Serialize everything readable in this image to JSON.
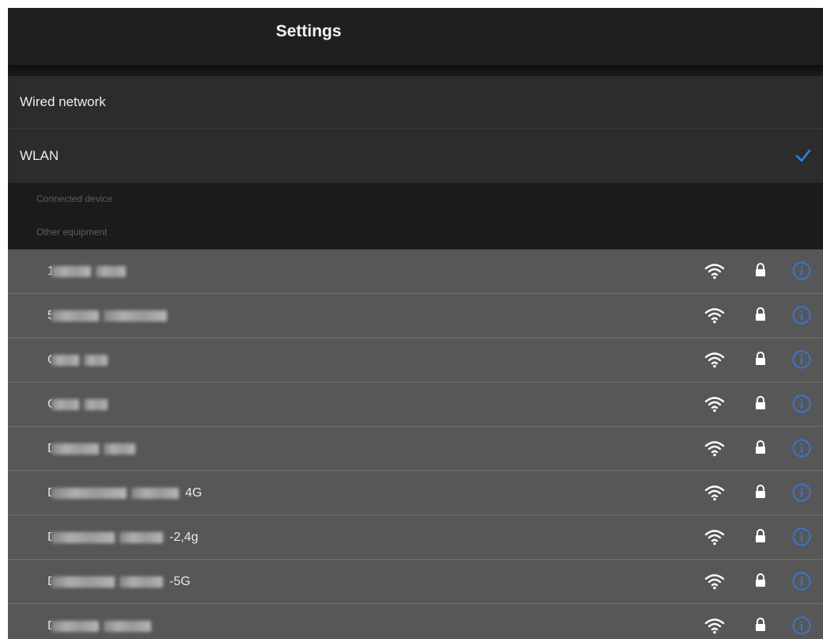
{
  "header": {
    "title": "Settings"
  },
  "menu": {
    "wired_label": "Wired network",
    "wlan_label": "WLAN",
    "wlan_checked": true,
    "accent_color": "#2f7df2"
  },
  "sections": {
    "connected_label": "Connected device",
    "other_label": "Other equipment"
  },
  "networks": [
    {
      "first": "1",
      "suffix": "",
      "secured": true
    },
    {
      "first": "5",
      "suffix": "",
      "secured": true
    },
    {
      "first": "C",
      "suffix": "",
      "secured": true
    },
    {
      "first": "C",
      "suffix": "",
      "secured": true
    },
    {
      "first": "D",
      "suffix": "",
      "secured": true
    },
    {
      "first": "D",
      "suffix": "4G",
      "secured": true
    },
    {
      "first": "D",
      "suffix": "-2,4g",
      "secured": true
    },
    {
      "first": "D",
      "suffix": "-5G",
      "secured": true
    },
    {
      "first": "D",
      "suffix": "",
      "secured": true
    }
  ],
  "icons": {
    "wifi": "wifi-icon",
    "lock": "lock-icon",
    "info": "info-icon",
    "check": "checkmark-icon"
  }
}
